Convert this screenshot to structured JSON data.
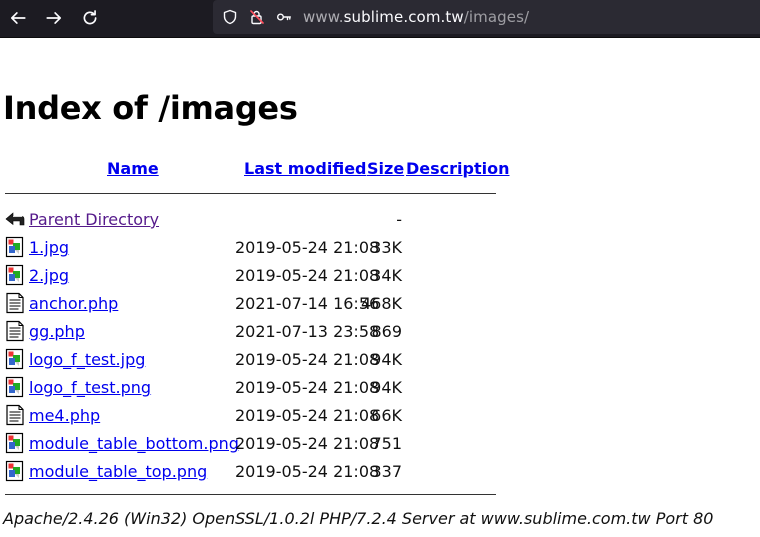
{
  "browser": {
    "url_host_prefix": "www.",
    "url_host_domain": "sublime.com.tw",
    "url_path": "/images/"
  },
  "page": {
    "title": "Index of /images",
    "columns": {
      "name": "Name",
      "last_modified": "Last modified",
      "size": "Size",
      "description": "Description"
    },
    "rows": [
      {
        "name": "Parent Directory",
        "date": "",
        "size": "-",
        "icon": "back-icon"
      },
      {
        "name": "1.jpg",
        "date": "2019-05-24 21:08",
        "size": "33K",
        "icon": "image-file-icon"
      },
      {
        "name": "2.jpg",
        "date": "2019-05-24 21:08",
        "size": "34K",
        "icon": "image-file-icon"
      },
      {
        "name": "anchor.php",
        "date": "2021-07-14 16:56",
        "size": "468K",
        "icon": "text-file-icon"
      },
      {
        "name": "gg.php",
        "date": "2021-07-13 23:58",
        "size": "869",
        "icon": "text-file-icon"
      },
      {
        "name": "logo_f_test.jpg",
        "date": "2019-05-24 21:08",
        "size": "94K",
        "icon": "image-file-icon"
      },
      {
        "name": "logo_f_test.png",
        "date": "2019-05-24 21:08",
        "size": "94K",
        "icon": "image-file-icon"
      },
      {
        "name": "me4.php",
        "date": "2019-05-24 21:08",
        "size": "66K",
        "icon": "text-file-icon"
      },
      {
        "name": "module_table_bottom.png",
        "date": "2019-05-24 21:08",
        "size": "751",
        "icon": "image-file-icon"
      },
      {
        "name": "module_table_top.png",
        "date": "2019-05-24 21:08",
        "size": "337",
        "icon": "image-file-icon"
      }
    ],
    "footer": "Apache/2.4.26 (Win32) OpenSSL/1.0.2l PHP/7.2.4 Server at www.sublime.com.tw Port 80"
  }
}
